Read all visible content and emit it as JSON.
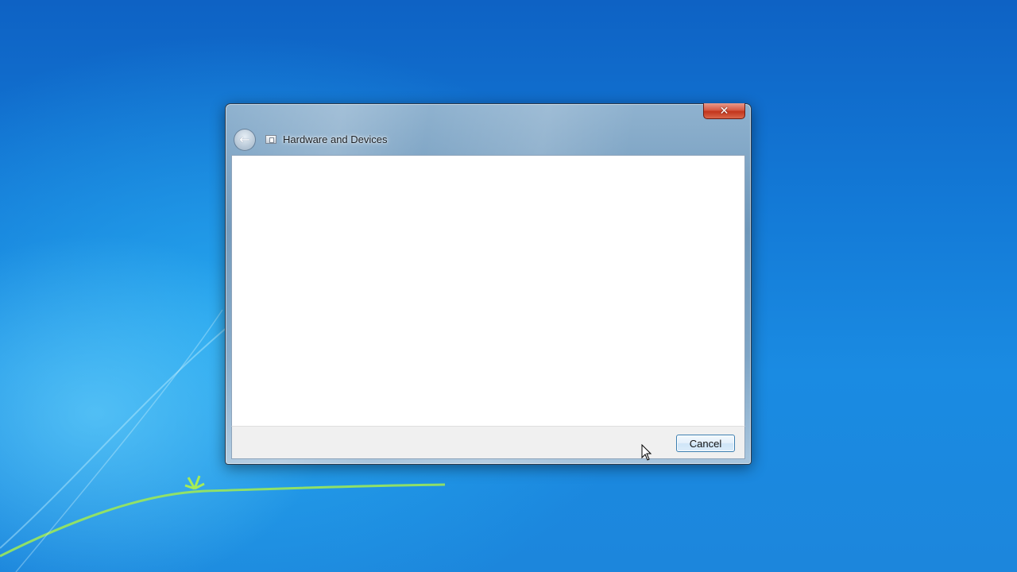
{
  "desktop": {
    "wallpaper": "windows-7-default",
    "colors": {
      "background": "#1379d6",
      "swoosh_green": "#8fe04a"
    }
  },
  "dialog": {
    "title": "Hardware and Devices",
    "title_icon": "control-panel-icon",
    "back_icon": "back-arrow-icon",
    "close_icon": "close-icon",
    "close_glyph": "✕",
    "back_glyph": "←",
    "cancel_label": "Cancel",
    "colors": {
      "close_button": "#c2351c",
      "frame": "#7ea5c6",
      "footer": "#f0f0f0",
      "content": "#ffffff"
    }
  },
  "cursor": {
    "icon": "arrow-cursor-icon"
  }
}
